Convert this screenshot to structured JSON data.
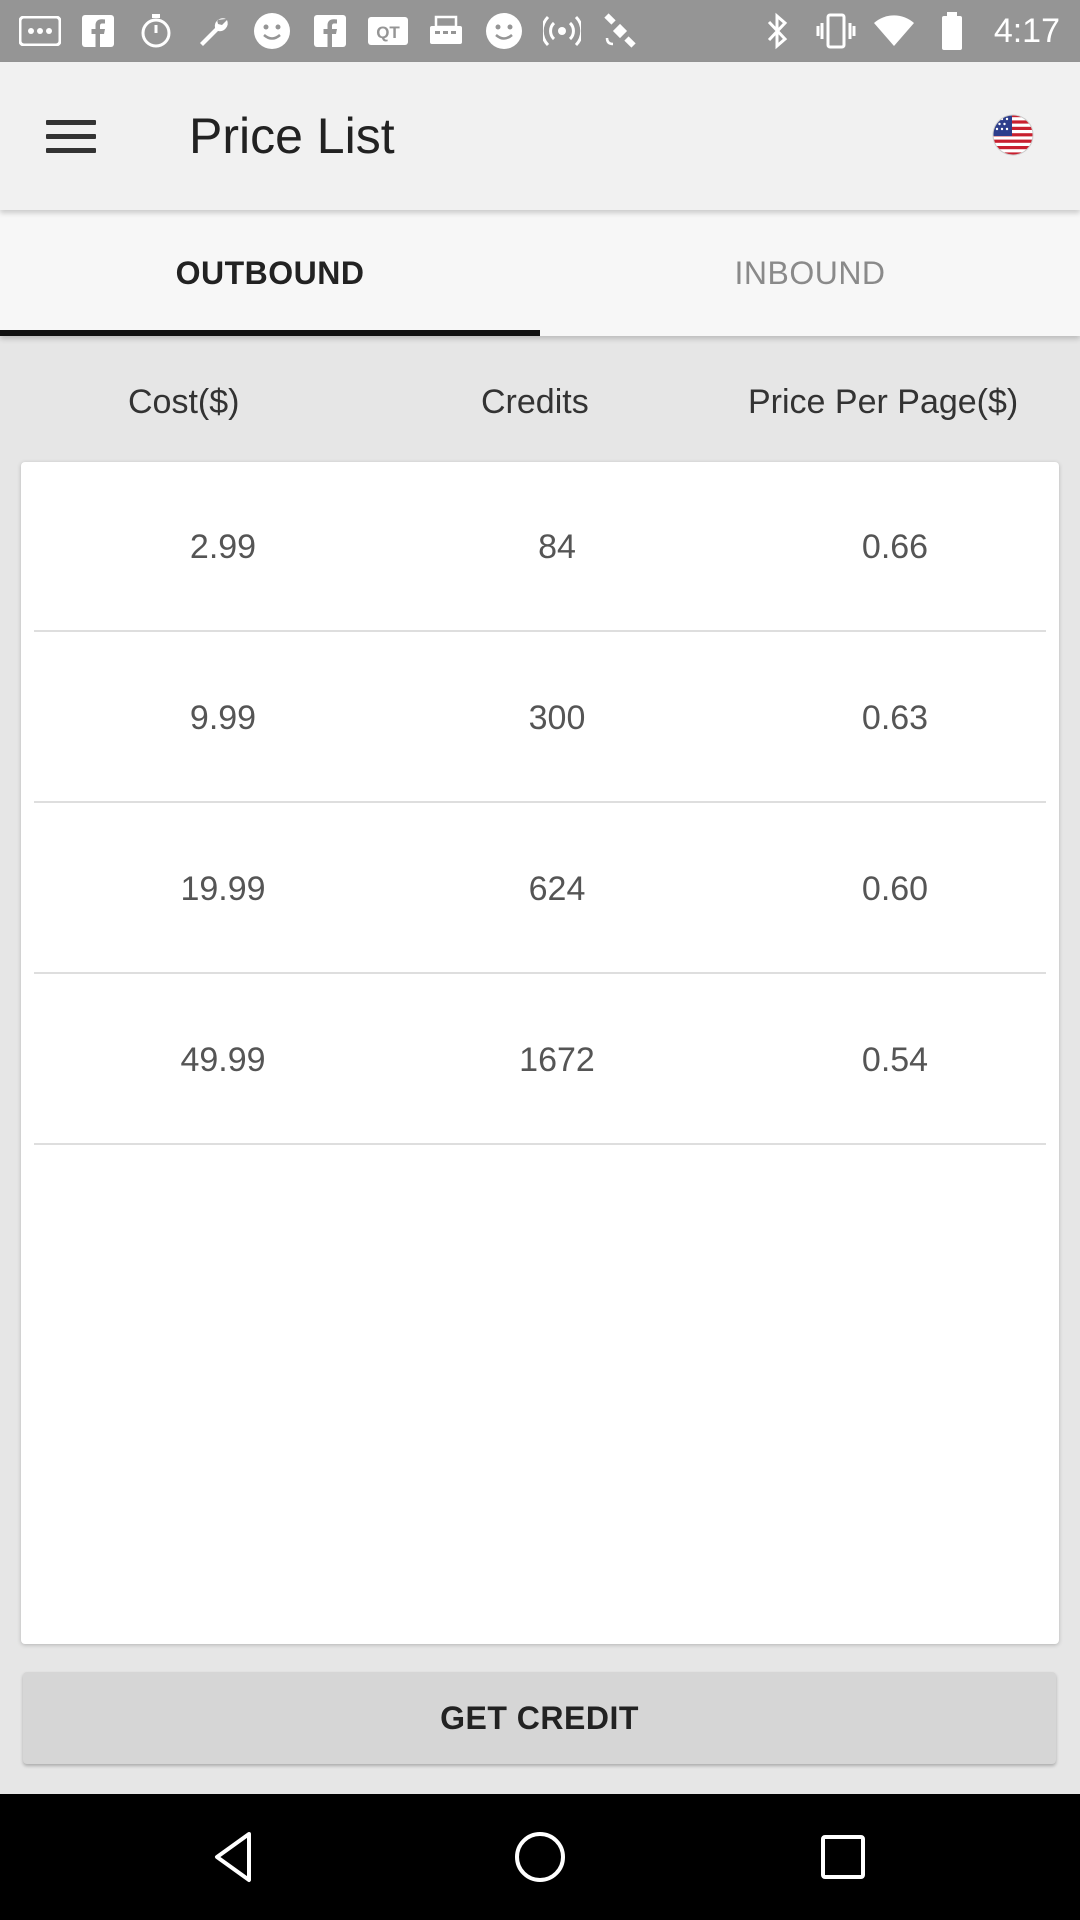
{
  "status_bar": {
    "time": "4:17",
    "icons": [
      "more-icon",
      "facebook-icon",
      "stopwatch-icon",
      "wrench-icon",
      "smiley-icon",
      "facebook-icon",
      "qt-icon",
      "fax-icon",
      "smiley-icon",
      "signal-hotspot-icon",
      "satellite-icon",
      "bluetooth-icon",
      "vibrate-icon",
      "wifi-icon",
      "battery-icon"
    ]
  },
  "app_bar": {
    "title": "Price List",
    "menu_icon": "hamburger-menu-icon",
    "flag_icon": "us-flag-icon"
  },
  "tabs": [
    {
      "label": "OUTBOUND",
      "selected": true
    },
    {
      "label": "INBOUND",
      "selected": false
    }
  ],
  "table": {
    "headers": [
      "Cost($)",
      "Credits",
      "Price Per Page($)"
    ],
    "rows": [
      [
        "2.99",
        "84",
        "0.66"
      ],
      [
        "9.99",
        "300",
        "0.63"
      ],
      [
        "19.99",
        "624",
        "0.60"
      ],
      [
        "49.99",
        "1672",
        "0.54"
      ]
    ]
  },
  "action": {
    "get_credit_label": "GET CREDIT"
  },
  "nav_bar": {
    "icons": [
      "back-icon",
      "home-icon",
      "recents-icon"
    ]
  },
  "colors": {
    "status_bar": "#959595",
    "app_bar": "#f1f1f1",
    "background": "#e6e6e6",
    "tab_indicator": "#111111",
    "button": "#d6d6d6"
  }
}
